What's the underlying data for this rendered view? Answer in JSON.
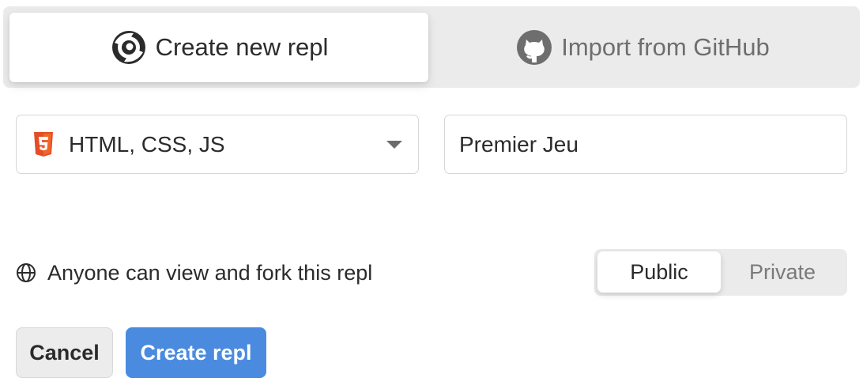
{
  "tabs": {
    "create_label": "Create new repl",
    "import_label": "Import from GitHub"
  },
  "template_select": {
    "value": "HTML, CSS, JS",
    "icon": "html5-icon"
  },
  "name_input": {
    "value": "Premier Jeu"
  },
  "visibility": {
    "description": "Anyone can view and fork this repl",
    "options": [
      "Public",
      "Private"
    ],
    "selected": "Public"
  },
  "actions": {
    "cancel_label": "Cancel",
    "create_label": "Create repl"
  },
  "colors": {
    "primary": "#4a8be0",
    "html5": "#e44d26"
  }
}
